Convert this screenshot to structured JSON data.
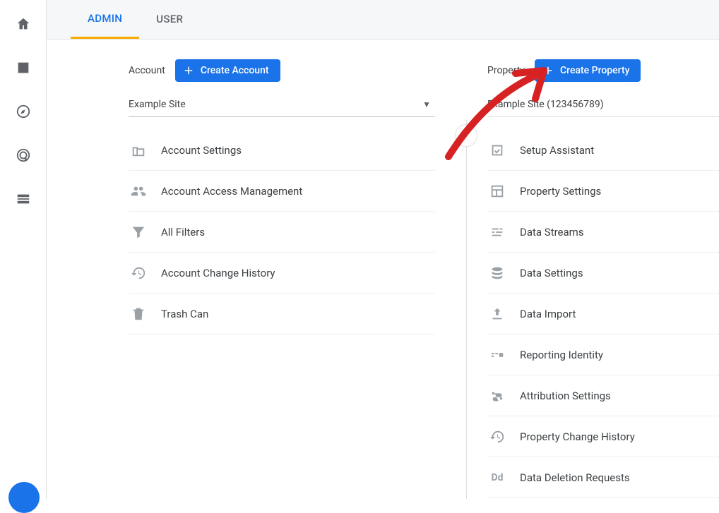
{
  "tabs": {
    "admin": "ADMIN",
    "user": "USER"
  },
  "account": {
    "label": "Account",
    "create_label": "Create Account",
    "selected": "Example Site",
    "items": [
      {
        "icon": "building-icon",
        "label": "Account Settings"
      },
      {
        "icon": "people-icon",
        "label": "Account Access Management"
      },
      {
        "icon": "funnel-icon",
        "label": "All Filters"
      },
      {
        "icon": "history-icon",
        "label": "Account Change History"
      },
      {
        "icon": "trash-icon",
        "label": "Trash Can"
      }
    ]
  },
  "property": {
    "label": "Property",
    "create_label": "Create Property",
    "selected": "Example Site (123456789)",
    "items": [
      {
        "icon": "checkbox-icon",
        "label": "Setup Assistant"
      },
      {
        "icon": "layout-icon",
        "label": "Property Settings"
      },
      {
        "icon": "streams-icon",
        "label": "Data Streams"
      },
      {
        "icon": "database-icon",
        "label": "Data Settings"
      },
      {
        "icon": "upload-icon",
        "label": "Data Import"
      },
      {
        "icon": "identity-icon",
        "label": "Reporting Identity"
      },
      {
        "icon": "attribution-icon",
        "label": "Attribution Settings"
      },
      {
        "icon": "history-icon",
        "label": "Property Change History"
      },
      {
        "icon": "dd-icon",
        "label": "Data Deletion Requests"
      }
    ]
  },
  "nav_icons": [
    "home-icon",
    "reports-icon",
    "explore-icon",
    "advertising-icon",
    "configure-icon"
  ]
}
